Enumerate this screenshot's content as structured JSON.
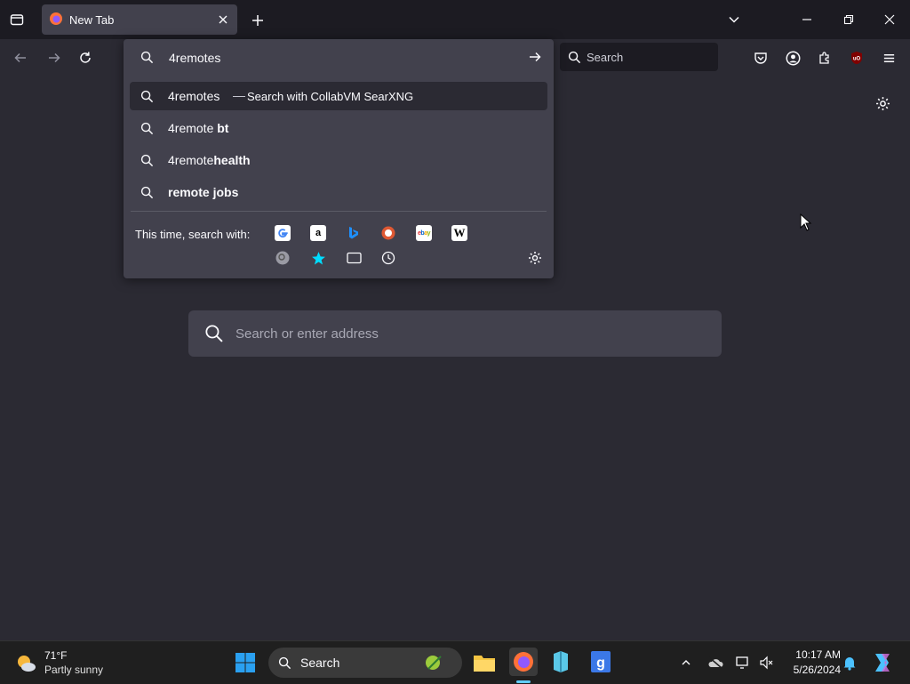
{
  "browser": {
    "tab": {
      "title": "New Tab"
    }
  },
  "toolbar": {
    "search_placeholder": "Search"
  },
  "urlbar": {
    "value": "4remotes",
    "suggestions": [
      {
        "typed": "4remotes",
        "bold": "",
        "action": "Search with CollabVM SearXNG"
      },
      {
        "typed": "4remote ",
        "bold": "bt"
      },
      {
        "typed": "4remote",
        "bold": "health"
      },
      {
        "typed": "",
        "bold": "remote jobs"
      }
    ],
    "engine_label": "This time, search with:",
    "engines": [
      "google-icon",
      "amazon-icon",
      "bing-icon",
      "duckduckgo-icon",
      "ebay-icon",
      "wikipedia-icon",
      "searxng-icon",
      "bookmarks-icon",
      "tabs-icon",
      "history-icon"
    ]
  },
  "newtab": {
    "search_placeholder": "Search or enter address"
  },
  "taskbar": {
    "weather_temp": "71°F",
    "weather_desc": "Partly sunny",
    "search_label": "Search",
    "time": "10:17 AM",
    "date": "5/26/2024"
  }
}
